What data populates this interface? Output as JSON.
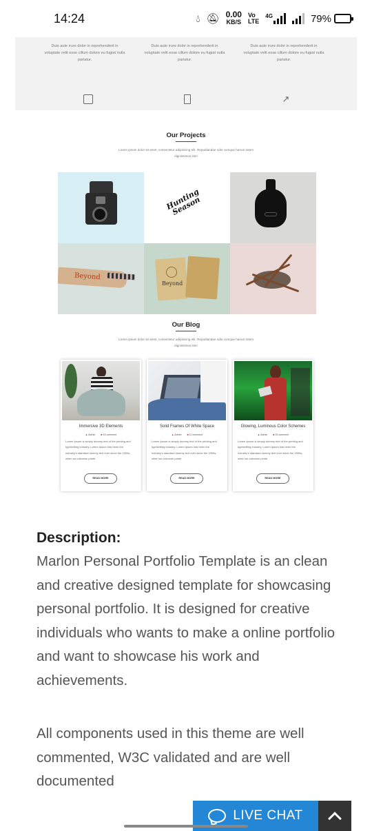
{
  "status_bar": {
    "time": "14:24",
    "net_speed_value": "0.00",
    "net_speed_unit": "KB/S",
    "volte_top": "Vo",
    "volte_bottom": "LTE",
    "network_type": "4G",
    "battery_percent": "79%",
    "battery_level": 0.79
  },
  "features": {
    "items": [
      {
        "text": "Duis aute irure dolor in reprehenderit in voluptate velit esse cillum dolore eu fugiat nulla pariatur.",
        "icon": "image-icon"
      },
      {
        "text": "Duis aute irure dolor in reprehenderit in voluptate velit esse cillum dolore eu fugiat nulla pariatur.",
        "icon": "book-icon"
      },
      {
        "text": "Duis aute irure dolor in reprehenderit in voluptate velit esse cillum dolore eu fugiat nulla pariatur.",
        "icon": "rocket-icon"
      }
    ]
  },
  "projects": {
    "title": "Our Projects",
    "subtitle": "Lorem ipsum dolor sit amet, consectetur adipisicing elit. Repudiandae odio cumque harum totam dignissimos iste!",
    "items": [
      {
        "name": "camera",
        "label": ""
      },
      {
        "name": "hunting-season-logo",
        "label": "Hunting Season"
      },
      {
        "name": "black-bottle",
        "label": ""
      },
      {
        "name": "pencil-case",
        "label": "Beyond"
      },
      {
        "name": "notebook",
        "label": "Beyond"
      },
      {
        "name": "brushes-bowl",
        "label": ""
      }
    ]
  },
  "blog": {
    "title": "Our Blog",
    "subtitle": "Lorem ipsum dolor sit amet, consectetur adipisicing elit. Repudiandae odio cumque harum totam dignissimos iste!",
    "posts": [
      {
        "title": "Immersive 3D Elements",
        "author": "Admin",
        "comments": "15 comment",
        "body": "Lorem Ipsum is simply dummy text of the printing and typesetting industry. Lorem Ipsum has been the industry's standard dummy text ever since the 1500s, when an unknown printe",
        "button": "READ MORE"
      },
      {
        "title": "Solid Frames Of White Space",
        "author": "Admin",
        "comments": "11 comment",
        "body": "Lorem Ipsum is simply dummy text of the printing and typesetting industry. Lorem Ipsum has been the industry's standard dummy text ever since the 1500s, when an unknown printe",
        "button": "READ MORE"
      },
      {
        "title": "Glowing, Luminous Color Schemes",
        "author": "Admin",
        "comments": "29 comment",
        "body": "Lorem Ipsum is simply dummy text of the printing and typesetting industry. Lorem Ipsum has been the industry's standard dummy text ever since the 1500s, when an unknown printe",
        "button": "READ MORE"
      }
    ]
  },
  "description": {
    "heading": "Description:",
    "paragraph1": "Marlon Personal Portfolio Template is an clean and creative designed template for showcasing personal portfolio. It is designed for creative individuals who wants to make a online portfolio and want to showcase his work and achievements.",
    "paragraph2": "All components used in this theme are well commented, W3C validated and are well documented"
  },
  "live_chat": {
    "label": "LIVE CHAT",
    "color": "#2387d6"
  },
  "colors": {
    "accent": "#2387d6",
    "scroll_top_bg": "#333333"
  }
}
